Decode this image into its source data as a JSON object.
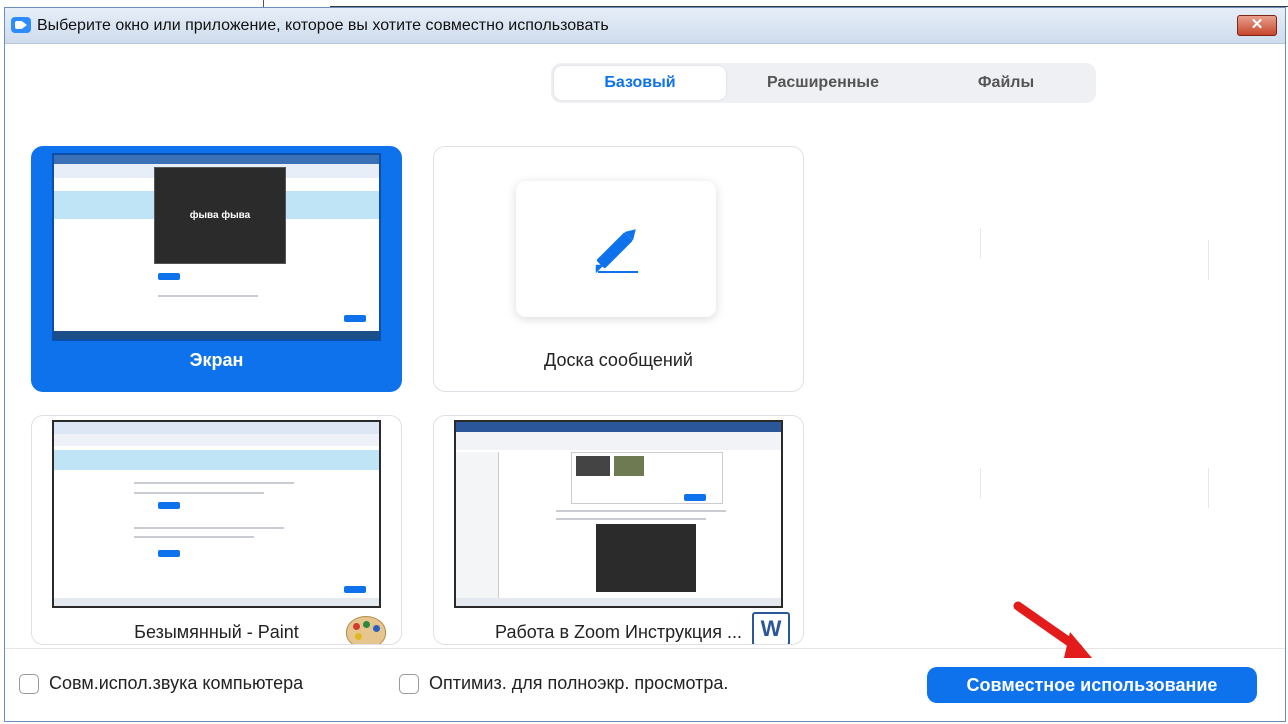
{
  "window": {
    "title": "Выберите окно или приложение, которое вы хотите совместно использовать",
    "close_label": "✕"
  },
  "tabs": [
    {
      "label": "Базовый",
      "active": true
    },
    {
      "label": "Расширенные",
      "active": false
    },
    {
      "label": "Файлы",
      "active": false
    }
  ],
  "tiles": [
    {
      "label": "Экран",
      "selected": true,
      "thumb_text": "фыва фыва"
    },
    {
      "label": "Доска сообщений",
      "selected": false
    },
    {
      "label": "Безымянный - Paint",
      "selected": false
    },
    {
      "label": "Работа в Zoom Инструкция ...",
      "selected": false
    }
  ],
  "footer": {
    "checkbox_audio": "Совм.испол.звука компьютера",
    "checkbox_optimize": "Оптимиз. для полноэкр. просмотра.",
    "share_button": "Совместное использование"
  },
  "colors": {
    "accent": "#0e72ed",
    "arrow": "#e31b1b",
    "tab_bg": "#eff0f3"
  },
  "icons": [
    "zoom-app-icon",
    "pencil-icon",
    "paint-icon",
    "word-icon",
    "close-icon"
  ]
}
